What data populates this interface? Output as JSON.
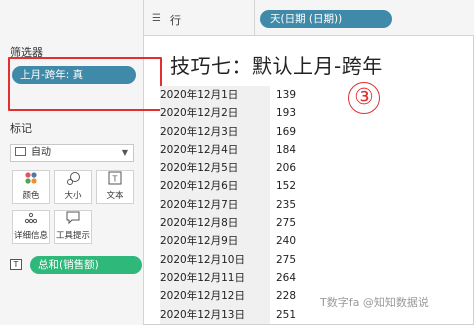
{
  "shelf": {
    "rows_icon": "rows-icon",
    "rows_label": "行",
    "pill_label": "天(日期 (日期))"
  },
  "left_panel": {
    "filters_title": "筛选器",
    "filter_pill": "上月-跨年: 真",
    "marks_title": "标记",
    "mark_type": "自动",
    "cards": [
      {
        "icon": "color-dots-icon",
        "label": "颜色"
      },
      {
        "icon": "size-icon",
        "label": "大小"
      },
      {
        "icon": "text-icon",
        "label": "文本"
      },
      {
        "icon": "detail-icon",
        "label": "详细信息"
      },
      {
        "icon": "tooltip-icon",
        "label": "工具提示"
      }
    ],
    "measure_pill": "总和(销售额)"
  },
  "view": {
    "title": "技巧七：默认上月-跨年",
    "marker": "③",
    "rows": [
      {
        "date": "2020年12月1日",
        "value": "139"
      },
      {
        "date": "2020年12月2日",
        "value": "193"
      },
      {
        "date": "2020年12月3日",
        "value": "169"
      },
      {
        "date": "2020年12月4日",
        "value": "184"
      },
      {
        "date": "2020年12月5日",
        "value": "206"
      },
      {
        "date": "2020年12月6日",
        "value": "152"
      },
      {
        "date": "2020年12月7日",
        "value": "235"
      },
      {
        "date": "2020年12月8日",
        "value": "275"
      },
      {
        "date": "2020年12月9日",
        "value": "240"
      },
      {
        "date": "2020年12月10日",
        "value": "275"
      },
      {
        "date": "2020年12月11日",
        "value": "264"
      },
      {
        "date": "2020年12月12日",
        "value": "228"
      },
      {
        "date": "2020年12月13日",
        "value": "251"
      }
    ]
  },
  "watermark": "T数字fa @知知数据说"
}
